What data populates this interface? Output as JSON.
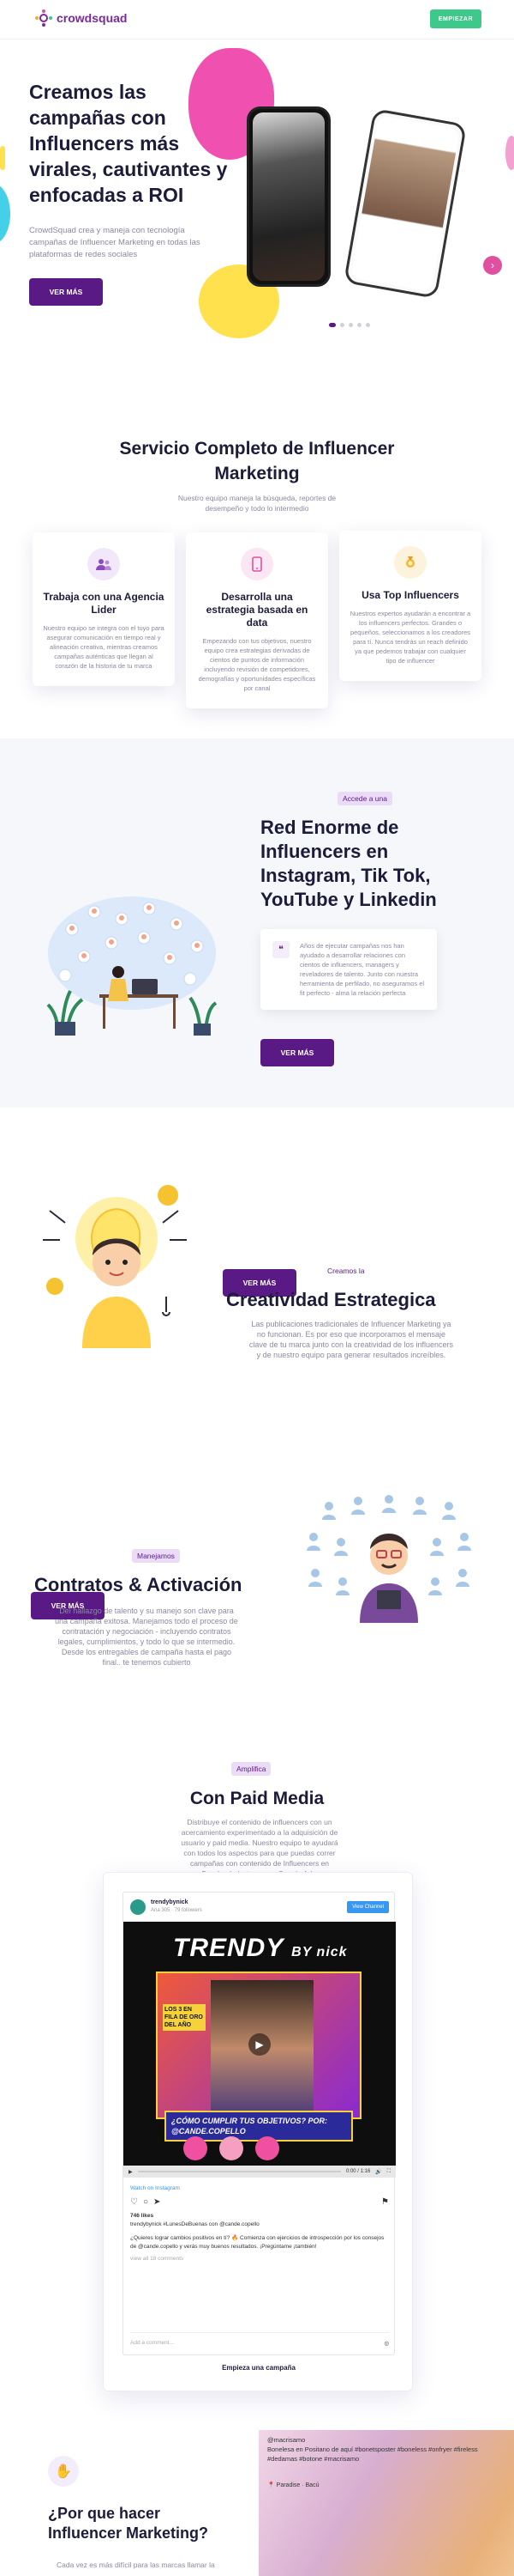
{
  "header": {
    "logo_text": "crowdsquad",
    "cta_label": "EMPIEZAR"
  },
  "hero": {
    "title": "Creamos las campañas con Influencers más virales, cautivantes y enfocadas a ROI",
    "description": "CrowdSquad crea y maneja con tecnología campañas de Influencer Marketing en todas las plataformas de redes sociales",
    "button_label": "VER MÁS"
  },
  "services": {
    "title": "Servicio Completo de Influencer Marketing",
    "subtitle": "Nuestro equipo maneja la búsqueda, reportes de desempeño y todo lo intermedio",
    "cards": [
      {
        "icon": "people-icon",
        "title": "Trabaja con una Agencia Lider",
        "text": "Nuestro equipo se integra con el tuyo para asegurar comunicación en tiempo real y alineación creativa, mientras creamos campañas auténticas que llegan al corazón de la historia de tu marca"
      },
      {
        "icon": "phone-icon",
        "title": "Desarrolla una estrategia basada en data",
        "text": "Empezando con tus objetivos, nuestro equipo crea estrategias derivadas de cientos de puntos de información incluyendo revisión de competidores, demografías y oportunidades específicas por canal"
      },
      {
        "icon": "medal-icon",
        "title": "Usa Top Influencers",
        "text": "Nuestros expertos ayudarán a encontrar a los influencers perfectos. Grandes o pequeños, seleccionamos a los creadores para tí. Nunca tendrás un reach definido ya que pedemos trabajar con cualquier tipo de influencer"
      }
    ]
  },
  "network": {
    "tag": "Accede a una",
    "title": "Red Enorme de Influencers en Instagram, Tik Tok, YouTube y Linkedin",
    "quote": "Años de ejecutar campañas nos han ayudado a desarrollar relaciones con cientos de influencers, managers y reveladores de talento. Junto con nuestra herramienta de perfilado, no aseguramos el fit perfecto - alma la relación perfecta",
    "button_label": "VER MÁS"
  },
  "creative": {
    "tag": "Creamos la",
    "title": "Creatividad Estrategica",
    "text": "Las publicaciones tradicionales de Influencer Marketing ya no funcionan. Es por eso que incorporamos el mensaje clave de tu marca junto con la creatividad de los influencers y de nuestro equipo para generar resultados increíbles.",
    "button_label": "VER MÁS"
  },
  "contracts": {
    "tag": "Manejamos",
    "title": "Contratos & Activación",
    "text": "Del hallazgo de talento y su manejo son clave para una campaña exitosa. Manejamos todo el proceso de contratación y negociación - incluyendo contratos legales, cumplimientos, y todo lo que se intermedio. Desde los entregables de campaña hasta el pago final.. te tenemos cubierto",
    "button_label": "VER MÁS"
  },
  "paid": {
    "tag": "Amplifica",
    "title": "Con Paid Media",
    "text": "Distribuye el contenido de influencers con un acercamiento experimentado a la adquisición de usuario y paid media. Nuestro equipo te ayudará con todos los aspectos para que puedas correr campañas con contenido de Influencers en Facebook, Instagram o Google Ads.",
    "post": {
      "username": "trendybynick",
      "meta": "Ana 305 · 79 followers",
      "view_label": "View Channel",
      "banner_title": "TRENDY",
      "banner_sub": "BY nick",
      "cover_text": "LOS 3 EN FILA DE ORO DEL AÑO",
      "promo_text": "¿CÓMO CUMPLIR TUS OBJETIVOS? POR: @CANDE.COPELLO",
      "time": "0:00 / 1:16",
      "watch_label": "Watch on Instagram",
      "likes": "746 likes",
      "caption": "trendybynick #LunesDeBuenas con @cande.copello",
      "caption2": "¿Quieres lograr cambios positivos en tí? 🔥 Comienza con ejercicios de introspección por los consejos de @cande.copello y verás muy buenos resultados. ¡Pregúntame ¡también!",
      "view_comments": "view all 18 comments",
      "add_comment": "Add a comment...",
      "footer": "Empieza una campaña"
    }
  },
  "why": {
    "title": "¿Por que hacer Influencer Marketing?",
    "text": "Cada vez es más difícil para las marcas llamar la",
    "photo_caption": "@macrisamo\nBonelesa en Positano de aquí #bonetsposter #boneless #onfryer #fireless #dedamas #botone #macrisamo",
    "photo_place": "📍 Paradise · Bacú"
  },
  "colors": {
    "brand_purple": "#5a1a86",
    "accent_green": "#3ec98a",
    "pink": "#f050b0",
    "yellow": "#ffe14d"
  }
}
